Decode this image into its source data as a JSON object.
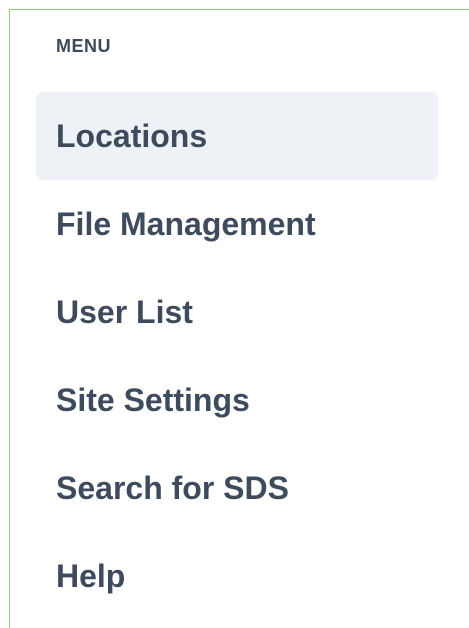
{
  "sidebar": {
    "heading": "MENU",
    "items": [
      {
        "label": "Locations",
        "active": true
      },
      {
        "label": "File Management",
        "active": false
      },
      {
        "label": "User List",
        "active": false
      },
      {
        "label": "Site Settings",
        "active": false
      },
      {
        "label": "Search for SDS",
        "active": false
      },
      {
        "label": "Help",
        "active": false
      }
    ]
  },
  "colors": {
    "border": "#8fcf6a",
    "active_background": "#eef2f6",
    "text": "#3e4b5c"
  }
}
